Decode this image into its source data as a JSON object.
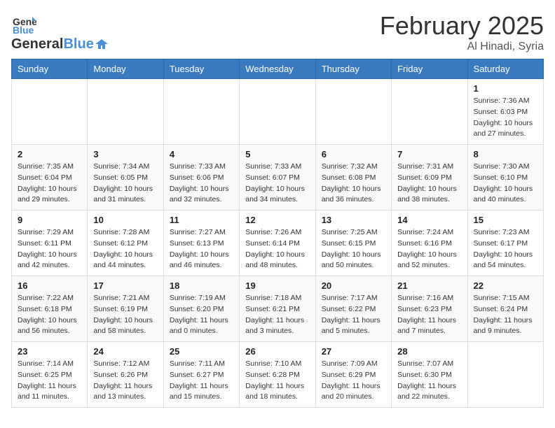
{
  "header": {
    "logo_general": "General",
    "logo_blue": "Blue",
    "month_title": "February 2025",
    "location": "Al Hinadi, Syria"
  },
  "days": [
    "Sunday",
    "Monday",
    "Tuesday",
    "Wednesday",
    "Thursday",
    "Friday",
    "Saturday"
  ],
  "weeks": [
    [
      {
        "date": "",
        "info": ""
      },
      {
        "date": "",
        "info": ""
      },
      {
        "date": "",
        "info": ""
      },
      {
        "date": "",
        "info": ""
      },
      {
        "date": "",
        "info": ""
      },
      {
        "date": "",
        "info": ""
      },
      {
        "date": "1",
        "info": "Sunrise: 7:36 AM\nSunset: 6:03 PM\nDaylight: 10 hours and 27 minutes."
      }
    ],
    [
      {
        "date": "2",
        "info": "Sunrise: 7:35 AM\nSunset: 6:04 PM\nDaylight: 10 hours and 29 minutes."
      },
      {
        "date": "3",
        "info": "Sunrise: 7:34 AM\nSunset: 6:05 PM\nDaylight: 10 hours and 31 minutes."
      },
      {
        "date": "4",
        "info": "Sunrise: 7:33 AM\nSunset: 6:06 PM\nDaylight: 10 hours and 32 minutes."
      },
      {
        "date": "5",
        "info": "Sunrise: 7:33 AM\nSunset: 6:07 PM\nDaylight: 10 hours and 34 minutes."
      },
      {
        "date": "6",
        "info": "Sunrise: 7:32 AM\nSunset: 6:08 PM\nDaylight: 10 hours and 36 minutes."
      },
      {
        "date": "7",
        "info": "Sunrise: 7:31 AM\nSunset: 6:09 PM\nDaylight: 10 hours and 38 minutes."
      },
      {
        "date": "8",
        "info": "Sunrise: 7:30 AM\nSunset: 6:10 PM\nDaylight: 10 hours and 40 minutes."
      }
    ],
    [
      {
        "date": "9",
        "info": "Sunrise: 7:29 AM\nSunset: 6:11 PM\nDaylight: 10 hours and 42 minutes."
      },
      {
        "date": "10",
        "info": "Sunrise: 7:28 AM\nSunset: 6:12 PM\nDaylight: 10 hours and 44 minutes."
      },
      {
        "date": "11",
        "info": "Sunrise: 7:27 AM\nSunset: 6:13 PM\nDaylight: 10 hours and 46 minutes."
      },
      {
        "date": "12",
        "info": "Sunrise: 7:26 AM\nSunset: 6:14 PM\nDaylight: 10 hours and 48 minutes."
      },
      {
        "date": "13",
        "info": "Sunrise: 7:25 AM\nSunset: 6:15 PM\nDaylight: 10 hours and 50 minutes."
      },
      {
        "date": "14",
        "info": "Sunrise: 7:24 AM\nSunset: 6:16 PM\nDaylight: 10 hours and 52 minutes."
      },
      {
        "date": "15",
        "info": "Sunrise: 7:23 AM\nSunset: 6:17 PM\nDaylight: 10 hours and 54 minutes."
      }
    ],
    [
      {
        "date": "16",
        "info": "Sunrise: 7:22 AM\nSunset: 6:18 PM\nDaylight: 10 hours and 56 minutes."
      },
      {
        "date": "17",
        "info": "Sunrise: 7:21 AM\nSunset: 6:19 PM\nDaylight: 10 hours and 58 minutes."
      },
      {
        "date": "18",
        "info": "Sunrise: 7:19 AM\nSunset: 6:20 PM\nDaylight: 11 hours and 0 minutes."
      },
      {
        "date": "19",
        "info": "Sunrise: 7:18 AM\nSunset: 6:21 PM\nDaylight: 11 hours and 3 minutes."
      },
      {
        "date": "20",
        "info": "Sunrise: 7:17 AM\nSunset: 6:22 PM\nDaylight: 11 hours and 5 minutes."
      },
      {
        "date": "21",
        "info": "Sunrise: 7:16 AM\nSunset: 6:23 PM\nDaylight: 11 hours and 7 minutes."
      },
      {
        "date": "22",
        "info": "Sunrise: 7:15 AM\nSunset: 6:24 PM\nDaylight: 11 hours and 9 minutes."
      }
    ],
    [
      {
        "date": "23",
        "info": "Sunrise: 7:14 AM\nSunset: 6:25 PM\nDaylight: 11 hours and 11 minutes."
      },
      {
        "date": "24",
        "info": "Sunrise: 7:12 AM\nSunset: 6:26 PM\nDaylight: 11 hours and 13 minutes."
      },
      {
        "date": "25",
        "info": "Sunrise: 7:11 AM\nSunset: 6:27 PM\nDaylight: 11 hours and 15 minutes."
      },
      {
        "date": "26",
        "info": "Sunrise: 7:10 AM\nSunset: 6:28 PM\nDaylight: 11 hours and 18 minutes."
      },
      {
        "date": "27",
        "info": "Sunrise: 7:09 AM\nSunset: 6:29 PM\nDaylight: 11 hours and 20 minutes."
      },
      {
        "date": "28",
        "info": "Sunrise: 7:07 AM\nSunset: 6:30 PM\nDaylight: 11 hours and 22 minutes."
      },
      {
        "date": "",
        "info": ""
      }
    ]
  ]
}
